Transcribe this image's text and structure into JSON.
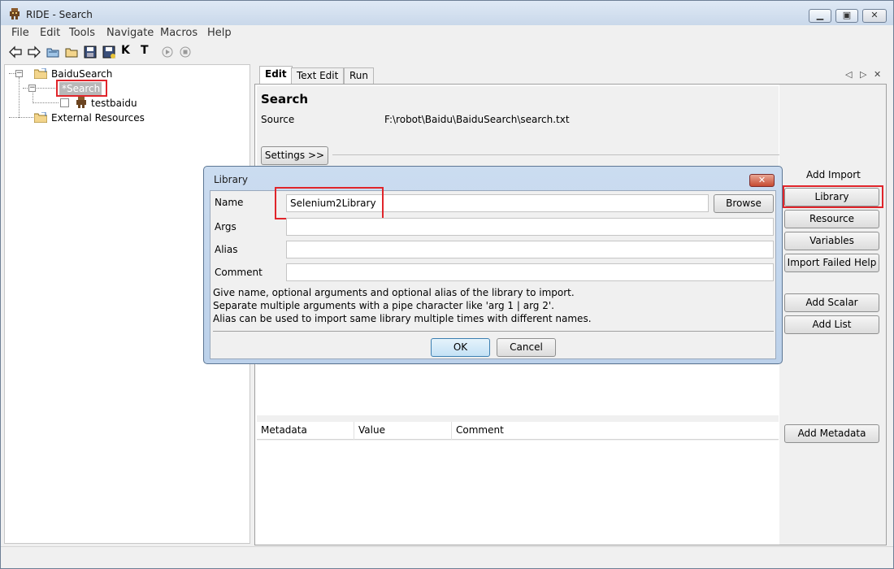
{
  "window": {
    "title": "RIDE - Search"
  },
  "menu": [
    "File",
    "Edit",
    "Tools",
    "Navigate",
    "Macros",
    "Help"
  ],
  "toolbar": {
    "icons": [
      "back-icon",
      "forward-icon",
      "open-dir-icon",
      "open-folder-icon",
      "save-icon",
      "save-all-icon",
      "keyword-search-icon",
      "text-search-icon",
      "run-icon",
      "stop-icon"
    ],
    "text_glyphs": [
      "K",
      "T"
    ]
  },
  "tree": {
    "root": "BaiduSearch",
    "suite": "*Search",
    "testcase": "testbaidu",
    "external": "External Resources"
  },
  "tabs": [
    "Edit",
    "Text Edit",
    "Run"
  ],
  "tab_nav": {
    "prev": "◁",
    "next": "▷",
    "close": "✕"
  },
  "suite": {
    "title": "Search",
    "source_label": "Source",
    "source_path": "F:\\robot\\Baidu\\BaiduSearch\\search.txt",
    "settings_button": "Settings >>"
  },
  "side_buttons": {
    "header": "Add Import",
    "library": "Library",
    "resource": "Resource",
    "variables": "Variables",
    "import_failed_help": "Import Failed Help",
    "add_scalar": "Add Scalar",
    "add_list": "Add List",
    "add_metadata": "Add Metadata"
  },
  "metadata_table": {
    "columns": [
      "Metadata",
      "Value",
      "Comment"
    ]
  },
  "dialog": {
    "title": "Library",
    "close": "✕",
    "name_label": "Name",
    "name_value": "Selenium2Library",
    "browse_button": "Browse",
    "args_label": "Args",
    "args_value": "",
    "alias_label": "Alias",
    "alias_value": "",
    "comment_label": "Comment",
    "comment_value": "",
    "help_lines": [
      "Give name, optional arguments and optional alias of the library to import.",
      "Separate multiple arguments with a pipe character like 'arg 1 | arg 2'.",
      "Alias can be used to import same library multiple times with different names."
    ],
    "ok_button": "OK",
    "cancel_button": "Cancel"
  },
  "colors": {
    "highlight": "#e0252b",
    "title_bar": "#c9d8ea",
    "dialog_frame": "#bcd1ea"
  }
}
